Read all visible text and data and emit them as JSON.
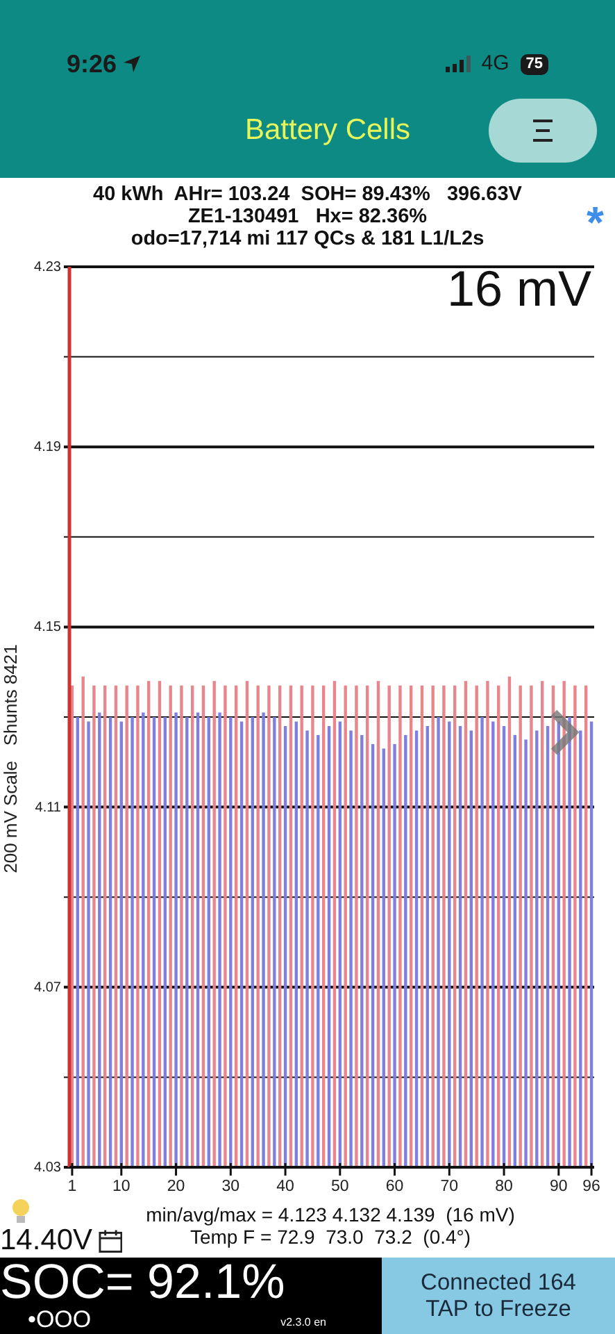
{
  "status_bar": {
    "time": "9:26",
    "network": "4G",
    "battery": "75"
  },
  "header": {
    "title": "Battery Cells"
  },
  "summary": {
    "lines": [
      "40 kWh  AHr= 103.24  SOH= 89.43%   396.63V",
      "ZE1-130491   Hx= 82.36%",
      "odo=17,714 mi 117 QCs & 181 L1/L2s"
    ],
    "asterisk": "*"
  },
  "chart": {
    "overlay_label": "16 mV",
    "chart_data": {
      "type": "bar",
      "ylabel": "200 mV Scale   Shunts 8421",
      "grid": true,
      "xlim": [
        0.5,
        96.5
      ],
      "ylim": [
        4.03,
        4.23
      ],
      "yticks": [
        4.03,
        4.07,
        4.11,
        4.15,
        4.19,
        4.23
      ],
      "xticks": [
        1,
        10,
        20,
        30,
        40,
        50,
        60,
        70,
        80,
        90,
        96
      ],
      "x": [
        1,
        2,
        3,
        4,
        5,
        6,
        7,
        8,
        9,
        10,
        11,
        12,
        13,
        14,
        15,
        16,
        17,
        18,
        19,
        20,
        21,
        22,
        23,
        24,
        25,
        26,
        27,
        28,
        29,
        30,
        31,
        32,
        33,
        34,
        35,
        36,
        37,
        38,
        39,
        40,
        41,
        42,
        43,
        44,
        45,
        46,
        47,
        48,
        49,
        50,
        51,
        52,
        53,
        54,
        55,
        56,
        57,
        58,
        59,
        60,
        61,
        62,
        63,
        64,
        65,
        66,
        67,
        68,
        69,
        70,
        71,
        72,
        73,
        74,
        75,
        76,
        77,
        78,
        79,
        80,
        81,
        82,
        83,
        84,
        85,
        86,
        87,
        88,
        89,
        90,
        91,
        92,
        93,
        94,
        95,
        96
      ],
      "series": [
        {
          "colors": [
            "#e8868c",
            "#7f7fe0",
            "#e8868c",
            "#7f7fe0",
            "#e8868c",
            "#7f7fe0",
            "#e8868c",
            "#7f7fe0",
            "#e8868c",
            "#7f7fe0",
            "#e8868c",
            "#7f7fe0",
            "#e8868c",
            "#7f7fe0",
            "#e8868c",
            "#7f7fe0",
            "#e8868c",
            "#7f7fe0",
            "#e8868c",
            "#7f7fe0",
            "#e8868c",
            "#7f7fe0",
            "#e8868c",
            "#7f7fe0",
            "#e8868c",
            "#7f7fe0",
            "#e8868c",
            "#7f7fe0",
            "#e8868c",
            "#7f7fe0",
            "#e8868c",
            "#7f7fe0",
            "#e8868c",
            "#7f7fe0",
            "#e8868c",
            "#7f7fe0",
            "#e8868c",
            "#7f7fe0",
            "#e8868c",
            "#7f7fe0",
            "#e8868c",
            "#7f7fe0",
            "#e8868c",
            "#7f7fe0",
            "#e8868c",
            "#7f7fe0",
            "#e8868c",
            "#7f7fe0",
            "#e8868c",
            "#7f7fe0",
            "#e8868c",
            "#7f7fe0",
            "#e8868c",
            "#7f7fe0",
            "#e8868c",
            "#7f7fe0",
            "#e8868c",
            "#7f7fe0",
            "#e8868c",
            "#7f7fe0",
            "#e8868c",
            "#7f7fe0",
            "#e8868c",
            "#7f7fe0",
            "#e8868c",
            "#7f7fe0",
            "#e8868c",
            "#7f7fe0",
            "#e8868c",
            "#7f7fe0",
            "#e8868c",
            "#7f7fe0",
            "#e8868c",
            "#7f7fe0",
            "#e8868c",
            "#7f7fe0",
            "#e8868c",
            "#7f7fe0",
            "#e8868c",
            "#7f7fe0",
            "#e8868c",
            "#7f7fe0",
            "#e8868c",
            "#7f7fe0",
            "#e8868c",
            "#7f7fe0",
            "#e8868c",
            "#7f7fe0",
            "#e8868c",
            "#7f7fe0",
            "#e8868c",
            "#7f7fe0",
            "#e8868c",
            "#7f7fe0",
            "#e8868c",
            "#7f7fe0"
          ],
          "values": [
            4.137,
            4.13,
            4.139,
            4.129,
            4.137,
            4.131,
            4.137,
            4.13,
            4.137,
            4.129,
            4.137,
            4.13,
            4.137,
            4.131,
            4.138,
            4.13,
            4.138,
            4.13,
            4.137,
            4.131,
            4.137,
            4.13,
            4.137,
            4.131,
            4.137,
            4.13,
            4.138,
            4.131,
            4.137,
            4.13,
            4.137,
            4.129,
            4.138,
            4.13,
            4.137,
            4.131,
            4.137,
            4.13,
            4.137,
            4.128,
            4.137,
            4.129,
            4.137,
            4.127,
            4.137,
            4.126,
            4.137,
            4.128,
            4.138,
            4.129,
            4.137,
            4.127,
            4.137,
            4.126,
            4.137,
            4.124,
            4.138,
            4.123,
            4.137,
            4.124,
            4.137,
            4.126,
            4.137,
            4.127,
            4.137,
            4.128,
            4.137,
            4.13,
            4.137,
            4.129,
            4.137,
            4.128,
            4.138,
            4.127,
            4.137,
            4.13,
            4.138,
            4.129,
            4.137,
            4.128,
            4.139,
            4.126,
            4.137,
            4.125,
            4.137,
            4.127,
            4.138,
            4.128,
            4.137,
            4.129,
            4.138,
            4.13,
            4.137,
            4.127,
            4.137,
            4.129
          ]
        }
      ]
    }
  },
  "stats": {
    "voltage": "14.40V",
    "min_avg_max": "min/avg/max = 4.123 4.132 4.139  (16 mV)",
    "temp": "Temp F = 72.9  73.0  73.2  (0.4°)"
  },
  "footer": {
    "soc": "SOC= 92.1%",
    "dots": "•OOO",
    "version": "v2.3.0 en",
    "status_lines": [
      "Connected 164",
      "TAP to Freeze"
    ]
  }
}
